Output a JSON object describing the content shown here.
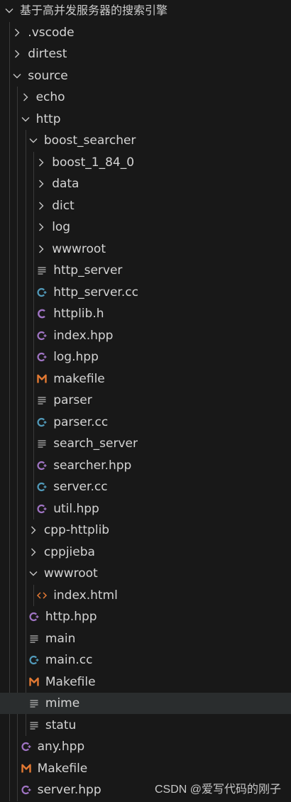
{
  "explorer": {
    "root": {
      "label": "基于高并发服务器的搜索引擎",
      "expanded": true
    },
    "items": [
      {
        "label": ".vscode",
        "type": "folder",
        "expanded": false,
        "depth": 1
      },
      {
        "label": "dirtest",
        "type": "folder",
        "expanded": false,
        "depth": 1
      },
      {
        "label": "source",
        "type": "folder",
        "expanded": true,
        "depth": 1
      },
      {
        "label": "echo",
        "type": "folder",
        "expanded": false,
        "depth": 2
      },
      {
        "label": "http",
        "type": "folder",
        "expanded": true,
        "depth": 2
      },
      {
        "label": "boost_searcher",
        "type": "folder",
        "expanded": true,
        "depth": 3
      },
      {
        "label": "boost_1_84_0",
        "type": "folder",
        "expanded": false,
        "depth": 4
      },
      {
        "label": "data",
        "type": "folder",
        "expanded": false,
        "depth": 4
      },
      {
        "label": "dict",
        "type": "folder",
        "expanded": false,
        "depth": 4
      },
      {
        "label": "log",
        "type": "folder",
        "expanded": false,
        "depth": 4
      },
      {
        "label": "wwwroot",
        "type": "folder",
        "expanded": false,
        "depth": 4
      },
      {
        "label": "http_server",
        "type": "text",
        "depth": 4
      },
      {
        "label": "http_server.cc",
        "type": "cpp",
        "depth": 4
      },
      {
        "label": "httplib.h",
        "type": "c-header",
        "depth": 4
      },
      {
        "label": "index.hpp",
        "type": "hpp",
        "depth": 4
      },
      {
        "label": "log.hpp",
        "type": "hpp",
        "depth": 4
      },
      {
        "label": "makefile",
        "type": "makefile",
        "depth": 4
      },
      {
        "label": "parser",
        "type": "text",
        "depth": 4
      },
      {
        "label": "parser.cc",
        "type": "cpp",
        "depth": 4
      },
      {
        "label": "search_server",
        "type": "text",
        "depth": 4
      },
      {
        "label": "searcher.hpp",
        "type": "hpp",
        "depth": 4
      },
      {
        "label": "server.cc",
        "type": "cpp",
        "depth": 4
      },
      {
        "label": "util.hpp",
        "type": "hpp",
        "depth": 4
      },
      {
        "label": "cpp-httplib",
        "type": "folder",
        "expanded": false,
        "depth": 3
      },
      {
        "label": "cppjieba",
        "type": "folder",
        "expanded": false,
        "depth": 3
      },
      {
        "label": "wwwroot",
        "type": "folder",
        "expanded": true,
        "depth": 3
      },
      {
        "label": "index.html",
        "type": "html",
        "depth": 4
      },
      {
        "label": "http.hpp",
        "type": "hpp",
        "depth": 3
      },
      {
        "label": "main",
        "type": "text",
        "depth": 3
      },
      {
        "label": "main.cc",
        "type": "cpp",
        "depth": 3
      },
      {
        "label": "Makefile",
        "type": "makefile",
        "depth": 3
      },
      {
        "label": "mime",
        "type": "text",
        "depth": 3,
        "selected": true
      },
      {
        "label": "statu",
        "type": "text",
        "depth": 3
      },
      {
        "label": "any.hpp",
        "type": "hpp",
        "depth": 2
      },
      {
        "label": "Makefile",
        "type": "makefile",
        "depth": 2
      },
      {
        "label": "server.hpp",
        "type": "hpp",
        "depth": 2
      }
    ]
  },
  "watermark": "CSDN @爱写代码的刚子",
  "colors": {
    "background": "#181818",
    "selected_row": "#2a2d2e",
    "text": "#d4d4d4",
    "cpp_icon": "#519aba",
    "hpp_icon": "#a074c4",
    "c_header_icon": "#a074c4",
    "makefile_icon": "#e37933",
    "html_icon": "#e37933",
    "text_icon": "#b8b8b8"
  }
}
